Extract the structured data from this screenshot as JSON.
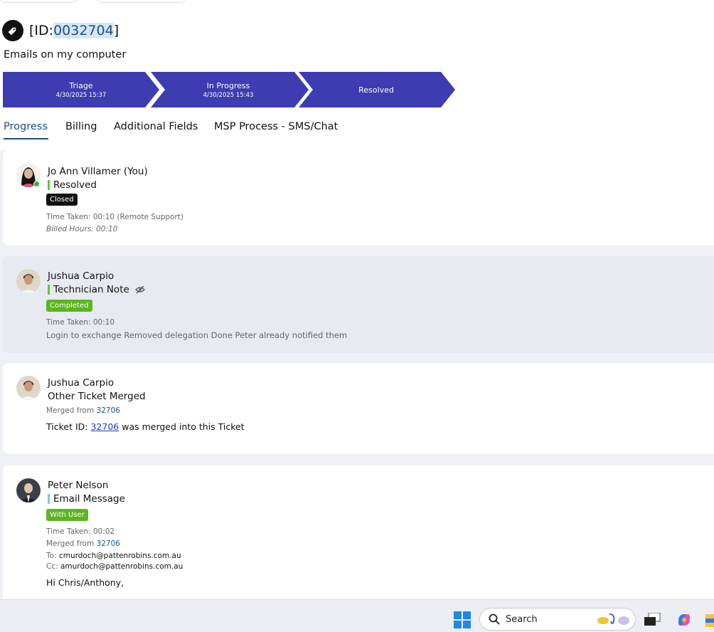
{
  "ticket": {
    "title_prefix": "[ID:",
    "id": "0032704",
    "title_suffix": "]",
    "subject": "Emails on my computer"
  },
  "pipeline": [
    {
      "name": "Triage",
      "date": "4/30/2025 15:37"
    },
    {
      "name": "In Progress",
      "date": "4/30/2025 15:43"
    },
    {
      "name": "Resolved",
      "date": ""
    }
  ],
  "tabs": [
    "Progress",
    "Billing",
    "Additional Fields",
    "MSP Process - SMS/Chat"
  ],
  "feed": [
    {
      "author": "Jo Ann Villamer (You)",
      "entry_type": "Resolved",
      "badge": "Closed",
      "time_taken": "Time Taken: 00:10 (Remote Support)",
      "billed": "Billed Hours: 00:10"
    },
    {
      "author": "Jushua Carpio",
      "entry_type": "Technician Note",
      "badge": "Completed",
      "time_taken": "Time Taken: 00:10",
      "note": "Login to exchange Removed delegation Done Peter already notified them"
    },
    {
      "author": "Jushua Carpio",
      "entry_type": "Other Ticket Merged",
      "merged_label": "Merged from",
      "merged_id": "32706",
      "body_prefix": "Ticket ID:",
      "body_link": "32706",
      "body_suffix": "was merged into this Ticket"
    },
    {
      "author": "Peter Nelson",
      "entry_type": "Email Message",
      "badge": "With User",
      "time_taken": "Time Taken: 00:02",
      "merged_label": "Merged from",
      "merged_id": "32706",
      "to_label": "To:",
      "to": "cmurdoch@pattenrobins.com.au",
      "cc_label": "Cc:",
      "cc": "amurdoch@pattenrobins.com.au",
      "greeting": "Hi Chris/Anthony,"
    }
  ],
  "taskbar": {
    "search_placeholder": "Search"
  },
  "colors": {
    "pipeline": "#3d3cb0",
    "tab_active": "#1c4f8a",
    "bar_green": "#5cc44a",
    "bar_blue": "#7fc7e6",
    "badge_closed": "#111111",
    "badge_green": "#5bb51f"
  }
}
